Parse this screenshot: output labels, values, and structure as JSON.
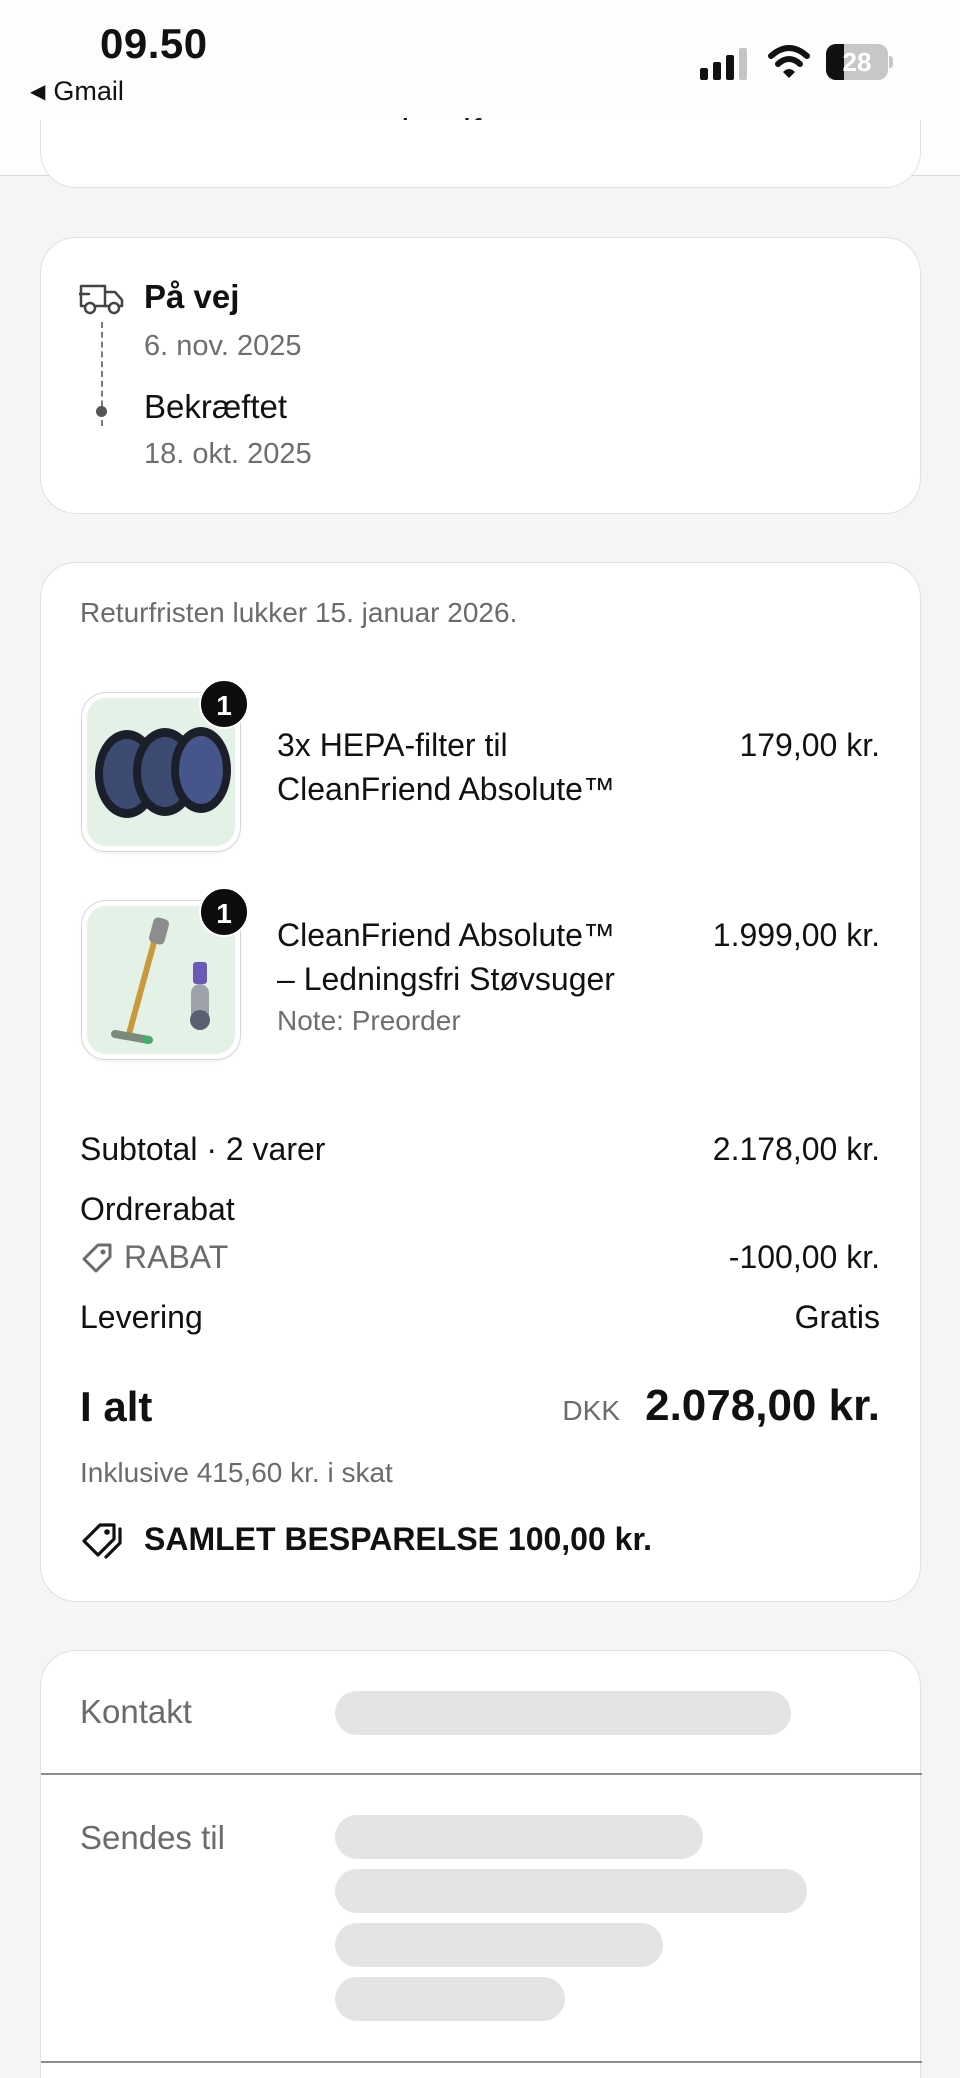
{
  "status_bar": {
    "time": "09.50",
    "back_app": "Gmail",
    "battery": "28"
  },
  "browser": {
    "url": "shopify.com"
  },
  "timeline": [
    {
      "title": "På vej",
      "date": "6. nov. 2025"
    },
    {
      "title": "Bekræftet",
      "date": "18. okt. 2025"
    }
  ],
  "order": {
    "return_note": "Returfristen lukker 15. januar 2026.",
    "items": [
      {
        "qty": "1",
        "name_line1": "3x HEPA-filter til",
        "name_line2": "CleanFriend Absolute™",
        "price": "179,00 kr.",
        "icon": "hepa-filter-image"
      },
      {
        "qty": "1",
        "name_line1": "CleanFriend Absolute™",
        "name_line2": "– Ledningsfri Støvsuger",
        "note": "Note: Preorder",
        "price": "1.999,00 kr.",
        "icon": "vacuum-cleaner-image"
      }
    ],
    "summary": {
      "subtotal_label": "Subtotal · 2 varer",
      "subtotal_value": "2.178,00 kr.",
      "discount_label": "Ordrerabat",
      "discount_code": "RABAT",
      "discount_value": "-100,00 kr.",
      "shipping_label": "Levering",
      "shipping_value": "Gratis",
      "total_label": "I alt",
      "total_currency": "DKK",
      "total_value": "2.078,00 kr.",
      "tax_note": "Inklusive 415,60 kr. i skat",
      "savings": "SAMLET BESPARELSE 100,00 kr."
    }
  },
  "contact": {
    "contact_label": "Kontakt",
    "ship_to_label": "Sendes til"
  },
  "colors": {
    "background": "#f5f5f5",
    "card": "#ffffff",
    "muted_text": "#6b6b6b",
    "badge": "#0d0d0d",
    "skeleton": "#e4e4e4"
  }
}
